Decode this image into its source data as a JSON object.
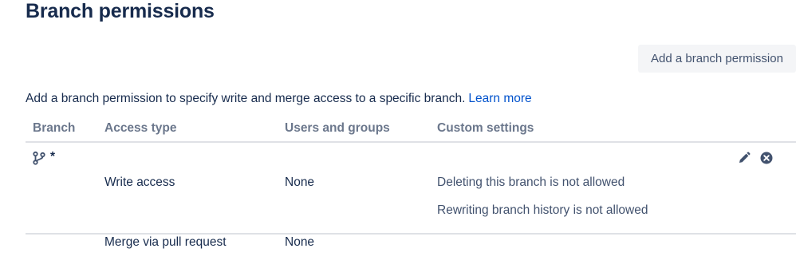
{
  "page": {
    "title": "Branch permissions"
  },
  "toolbar": {
    "add_button_label": "Add a branch permission"
  },
  "description": {
    "text": "Add a branch permission to specify write and merge access to a specific branch.",
    "link_label": "Learn more"
  },
  "table": {
    "columns": [
      "Branch",
      "Access type",
      "Users and groups",
      "Custom settings"
    ],
    "rows": [
      {
        "branch": "*",
        "branch_icon": "branch-icon",
        "permissions": [
          {
            "access_type": "Write access",
            "users": "None"
          },
          {
            "access_type": "Merge via pull request",
            "users": "None"
          }
        ],
        "custom_settings": [
          "Deleting this branch is not allowed",
          "Rewriting branch history is not allowed"
        ],
        "actions": [
          "edit-icon",
          "remove-icon"
        ]
      }
    ]
  },
  "colors": {
    "heading": "#172b4d",
    "column_header": "#6b778c",
    "link": "#0052cc",
    "button_bg": "#f4f5f7",
    "divider": "#dfe1e6"
  }
}
